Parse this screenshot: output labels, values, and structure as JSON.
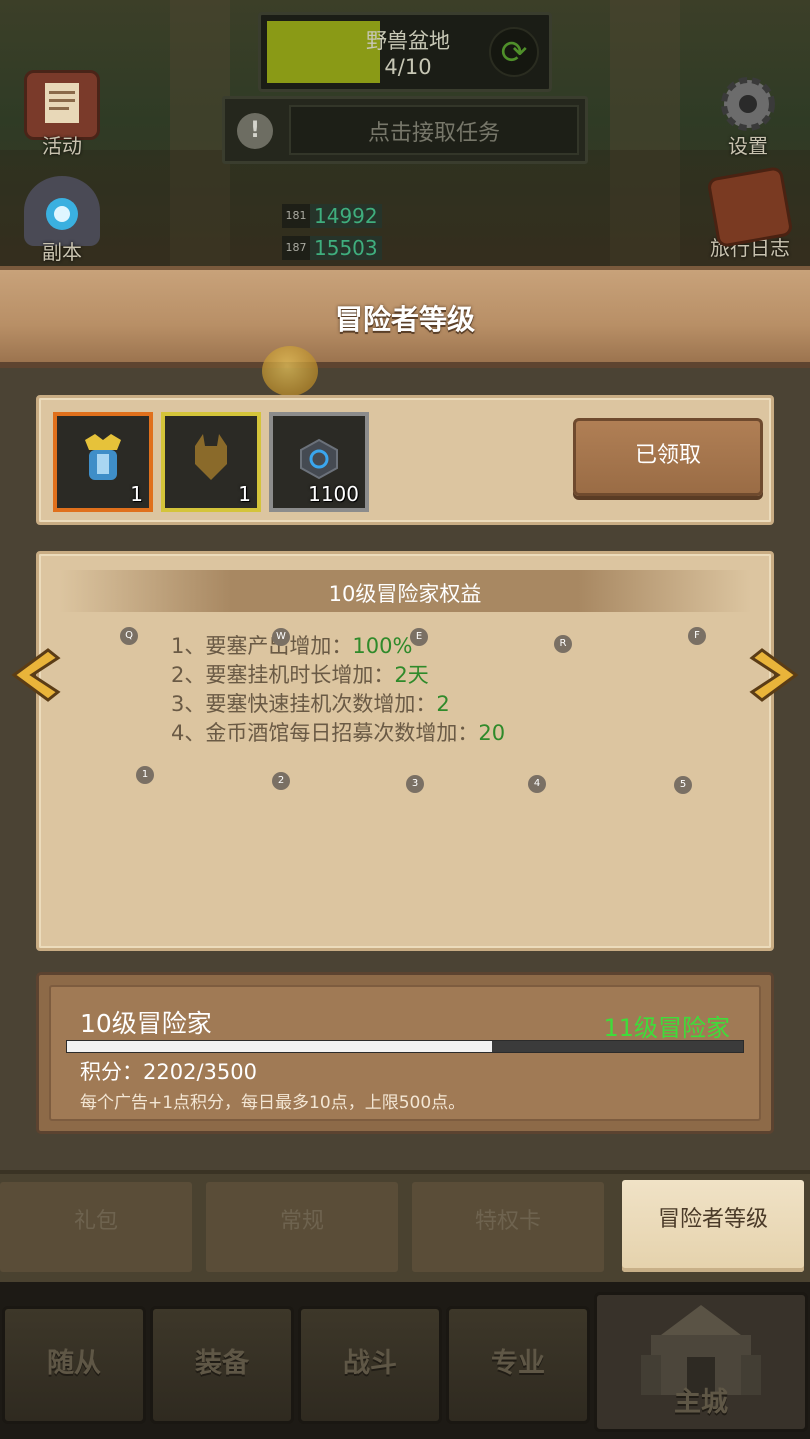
{
  "top": {
    "quest_name": "野兽盆地",
    "quest_count": "4/10",
    "quest_progress": 0.4,
    "task_label": "点击接取任务",
    "left_icons": [
      {
        "label": "活动",
        "icon": "activity-scroll-icon"
      },
      {
        "label": "副本",
        "icon": "dungeon-portal-icon"
      }
    ],
    "right_icons": [
      {
        "label": "设置",
        "icon": "gear-icon"
      },
      {
        "label": "旅行日志",
        "icon": "journal-book-icon"
      }
    ],
    "stats": [
      {
        "level": "181",
        "value": "14992"
      },
      {
        "level": "187",
        "value": "15503"
      }
    ]
  },
  "panel": {
    "title": "冒险者等级",
    "rewards": [
      {
        "icon": "armor-helmet-icon",
        "qty": "1",
        "rarity_color": "#e0701c"
      },
      {
        "icon": "chest-armor-icon",
        "qty": "1",
        "rarity_color": "#d4c43a"
      },
      {
        "icon": "gem-stone-icon",
        "qty": "1100",
        "rarity_color": "#8c8c8c"
      }
    ],
    "claim_button": "已领取",
    "benefits_title": "10级冒险家权益",
    "benefits": [
      {
        "text": "1、要塞产出增加：",
        "value": "100%"
      },
      {
        "text": "2、要塞挂机时长增加：",
        "value": "2天"
      },
      {
        "text": "3、要塞快速挂机次数增加：",
        "value": "2"
      },
      {
        "text": "4、金币酒馆每日招募次数增加：",
        "value": "20"
      }
    ],
    "markers_top": [
      "Q",
      "W",
      "E",
      "R",
      "F"
    ],
    "markers_bottom": [
      "1",
      "2",
      "3",
      "4",
      "5"
    ],
    "current_level": "10级冒险家",
    "next_level": "11级冒险家",
    "points": "积分：2202/3500",
    "points_progress": 0.629,
    "hint": "每个广告+1点积分，每日最多10点，上限500点。"
  },
  "tabs": [
    {
      "label": "礼包",
      "active": false
    },
    {
      "label": "常规",
      "active": false
    },
    {
      "label": "特权卡",
      "active": false
    },
    {
      "label": "冒险者等级",
      "active": true
    }
  ],
  "nav": [
    {
      "label": "随从"
    },
    {
      "label": "装备"
    },
    {
      "label": "战斗"
    },
    {
      "label": "专业"
    },
    {
      "label": "主城"
    }
  ],
  "colors": {
    "accent_green": "#2f8a2a",
    "next_level_green": "#3fdc3a",
    "parchment": "#dcc5a0",
    "wood": "#b88f66"
  }
}
